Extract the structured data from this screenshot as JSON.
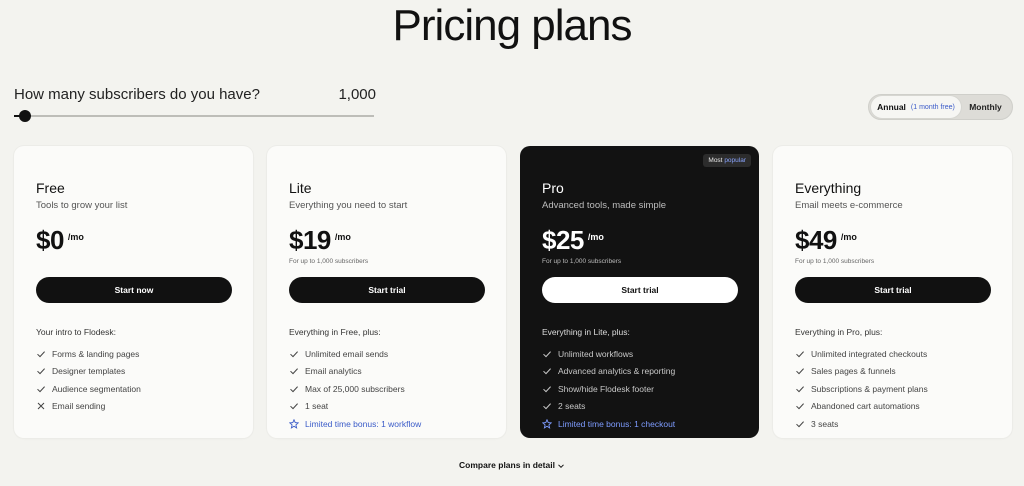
{
  "page": {
    "title": "Pricing plans"
  },
  "slider": {
    "question": "How many subscribers do you have?",
    "value": "1,000",
    "position_fraction": 0.03
  },
  "billing": {
    "annual_label": "Annual",
    "annual_note": "(1 month free)",
    "monthly_label": "Monthly",
    "selected": "Annual"
  },
  "plans": [
    {
      "name": "Free",
      "tagline": "Tools to grow your list",
      "price": "$0",
      "per": "/mo",
      "note": "",
      "cta": "Start now",
      "intro": "Your intro to Flodesk:",
      "features": [
        {
          "text": "Forms & landing pages",
          "icon": "check-icon"
        },
        {
          "text": "Designer templates",
          "icon": "check-icon"
        },
        {
          "text": "Audience segmentation",
          "icon": "check-icon"
        },
        {
          "text": "Email sending",
          "icon": "x-icon"
        }
      ]
    },
    {
      "name": "Lite",
      "tagline": "Everything you need to start",
      "price": "$19",
      "per": "/mo",
      "note": "For up to 1,000 subscribers",
      "cta": "Start trial",
      "intro": "Everything in Free, plus:",
      "features": [
        {
          "text": "Unlimited email sends",
          "icon": "check-icon"
        },
        {
          "text": "Email analytics",
          "icon": "check-icon"
        },
        {
          "text": "Max of 25,000 subscribers",
          "icon": "check-icon"
        },
        {
          "text": "1 seat",
          "icon": "check-icon"
        },
        {
          "text": "Limited time bonus: 1 workflow",
          "icon": "star-icon"
        }
      ]
    },
    {
      "name": "Pro",
      "tagline": "Advanced tools, made simple",
      "price": "$25",
      "per": "/mo",
      "note": "For up to 1,000 subscribers",
      "cta": "Start trial",
      "intro": "Everything in Lite, plus:",
      "badge_prefix": "Most",
      "badge_accent": "popular",
      "features": [
        {
          "text": "Unlimited workflows",
          "icon": "check-icon"
        },
        {
          "text": "Advanced analytics & reporting",
          "icon": "check-icon"
        },
        {
          "text": "Show/hide Flodesk footer",
          "icon": "check-icon"
        },
        {
          "text": "2 seats",
          "icon": "check-icon"
        },
        {
          "text": "Limited time bonus: 1 checkout",
          "icon": "star-icon"
        }
      ]
    },
    {
      "name": "Everything",
      "tagline": "Email meets e-commerce",
      "price": "$49",
      "per": "/mo",
      "note": "For up to 1,000 subscribers",
      "cta": "Start trial",
      "intro": "Everything in Pro, plus:",
      "features": [
        {
          "text": "Unlimited integrated checkouts",
          "icon": "check-icon"
        },
        {
          "text": "Sales pages & funnels",
          "icon": "check-icon"
        },
        {
          "text": "Subscriptions & payment plans",
          "icon": "check-icon"
        },
        {
          "text": "Abandoned cart automations",
          "icon": "check-icon"
        },
        {
          "text": "3 seats",
          "icon": "check-icon"
        }
      ]
    }
  ],
  "compare": {
    "label": "Compare plans in detail"
  },
  "colors": {
    "background": "#f3f3ef",
    "dark_card": "#121212",
    "accent": "#3a5bc8"
  }
}
